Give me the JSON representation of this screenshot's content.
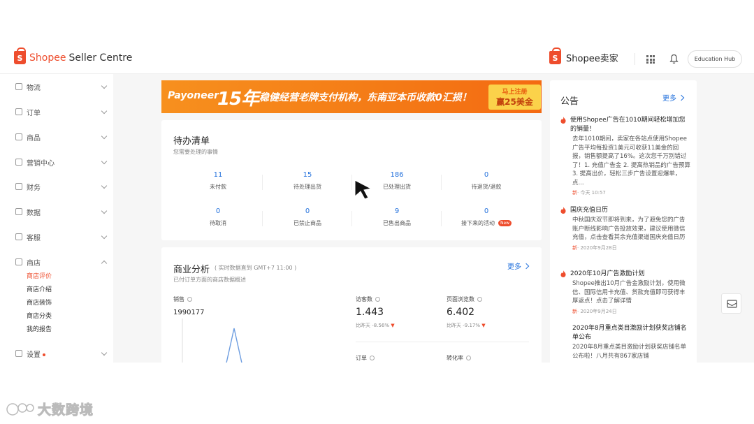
{
  "header": {
    "brand": "Shopee",
    "product": "Seller Centre",
    "right_brand": "Shopee卖家",
    "education_hub": "Education Hub"
  },
  "sidebar": {
    "items": [
      {
        "label": "物流",
        "icon": "truck-icon",
        "expanded": false
      },
      {
        "label": "订单",
        "icon": "clipboard-icon",
        "expanded": false
      },
      {
        "label": "商品",
        "icon": "box-icon",
        "expanded": false
      },
      {
        "label": "营销中心",
        "icon": "tag-icon",
        "expanded": false
      },
      {
        "label": "财务",
        "icon": "wallet-icon",
        "expanded": false
      },
      {
        "label": "数据",
        "icon": "chart-icon",
        "expanded": false
      },
      {
        "label": "客服",
        "icon": "chat-icon",
        "expanded": false
      },
      {
        "label": "商店",
        "icon": "store-icon",
        "expanded": true
      },
      {
        "label": "设置",
        "icon": "gear-icon",
        "expanded": false,
        "has_dot": true
      }
    ],
    "store_sub": [
      "商店评价",
      "商店介绍",
      "商店装饰",
      "商店分类",
      "我的报告"
    ],
    "active_sub": "商店评价"
  },
  "banner": {
    "brand": "Payoneer",
    "years": "15年",
    "slogan": "稳健经营老牌支付机构，东南亚本币收款0汇损！",
    "cta_top": "马上注册",
    "cta_bottom": "赢25美金"
  },
  "todo": {
    "title": "待办清单",
    "subtitle": "您需要处理的事情",
    "row1": [
      {
        "value": "11",
        "label": "未付款"
      },
      {
        "value": "15",
        "label": "待处理出货"
      },
      {
        "value": "186",
        "label": "已处理出货"
      },
      {
        "value": "0",
        "label": "待退货/退款"
      }
    ],
    "row2": [
      {
        "value": "0",
        "label": "待取消"
      },
      {
        "value": "0",
        "label": "已禁止商品"
      },
      {
        "value": "9",
        "label": "已售出商品"
      },
      {
        "value": "0",
        "label": "接下来的活动"
      }
    ],
    "new_badge": "New"
  },
  "business": {
    "title": "商业分析",
    "meta": "( 实时数据直到 GMT+7 11:00 )",
    "subtitle": "已付订单方面的商店数据概述",
    "more": "更多",
    "sales_label": "销售",
    "sales_value": "1990177",
    "visitors_label": "访客数",
    "visitors_value": "1.443",
    "visitors_cmp_prefix": "比昨天",
    "visitors_cmp": "-8.56%",
    "pageviews_label": "页面浏览数",
    "pageviews_value": "6.402",
    "pageviews_cmp_prefix": "比昨天",
    "pageviews_cmp": "-9.17%",
    "orders_label": "订单",
    "conversion_label": "转化率"
  },
  "announcements": {
    "title": "公告",
    "more": "更多",
    "items": [
      {
        "title": "使用Shopee广告在1010期间轻松增加您的销量！",
        "hot": true,
        "body": "去年1010期间，卖家在各站点使用Shopee广告平均每投资1美元可收获11美金的回报，销售额提高了16%。这次您千万别错过了！1. 充值广告金 2. 提高热销品的广告预算3. 提高出价，轻松三步广告设置迎爆单，点...",
        "date_new": "新",
        "date": "· 今天 10:57"
      },
      {
        "title": "国庆充值日历",
        "hot": true,
        "body": "中秋国庆双节即将到来，为了避免您的广告账户断线影响广告投放效果，建议使用微信充值，点击查看其余充值渠道国庆充值日历",
        "date_new": "新",
        "date": "· 2020年9月28日"
      },
      {
        "title": "2020年10月广告激励计划",
        "hot": true,
        "body": "Shopee推出10月广告金激励计划，使用微信、国际信用卡充值、货款充值即可获得丰厚返点！点击了解详情",
        "date_new": "新",
        "date": "· 2020年9月24日"
      },
      {
        "title": "2020年8月重点类目激励计划获奖店铺名单公布",
        "hot": false,
        "body": "2020年8月重点类目激励计划获奖店铺名单公布啦！八月共有867家店铺",
        "date_new": "",
        "date": ""
      }
    ]
  },
  "watermark": "大数跨境",
  "colors": {
    "brand": "#ee4d2d",
    "link": "#2673dd",
    "banner": "#f47a16"
  }
}
